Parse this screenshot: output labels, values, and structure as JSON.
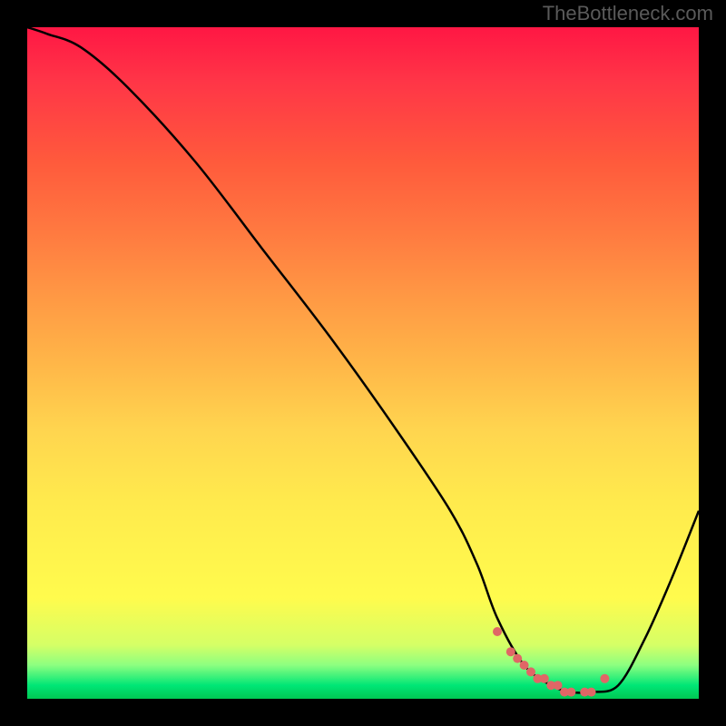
{
  "watermark": "TheBottleneck.com",
  "colors": {
    "background": "#000000",
    "gradient_top": "#ff1744",
    "gradient_bottom": "#00c853",
    "curve": "#000000",
    "markers": "#e06666"
  },
  "chart_data": {
    "type": "line",
    "title": "",
    "xlabel": "",
    "ylabel": "",
    "xlim": [
      0,
      100
    ],
    "ylim": [
      0,
      100
    ],
    "series": [
      {
        "name": "bottleneck-curve",
        "x": [
          0,
          3,
          8,
          15,
          25,
          35,
          45,
          55,
          63,
          67,
          70,
          74,
          78,
          81,
          84,
          88,
          92,
          96,
          100
        ],
        "values": [
          100,
          99,
          97,
          91,
          80,
          67,
          54,
          40,
          28,
          20,
          12,
          5,
          2,
          1,
          1,
          2,
          9,
          18,
          28
        ]
      }
    ],
    "markers": {
      "name": "highlight-dots",
      "x": [
        70,
        72,
        73,
        74,
        75,
        76,
        77,
        78,
        79,
        80,
        81,
        83,
        84,
        86
      ],
      "values": [
        10,
        7,
        6,
        5,
        4,
        3,
        3,
        2,
        2,
        1,
        1,
        1,
        1,
        3
      ]
    }
  }
}
